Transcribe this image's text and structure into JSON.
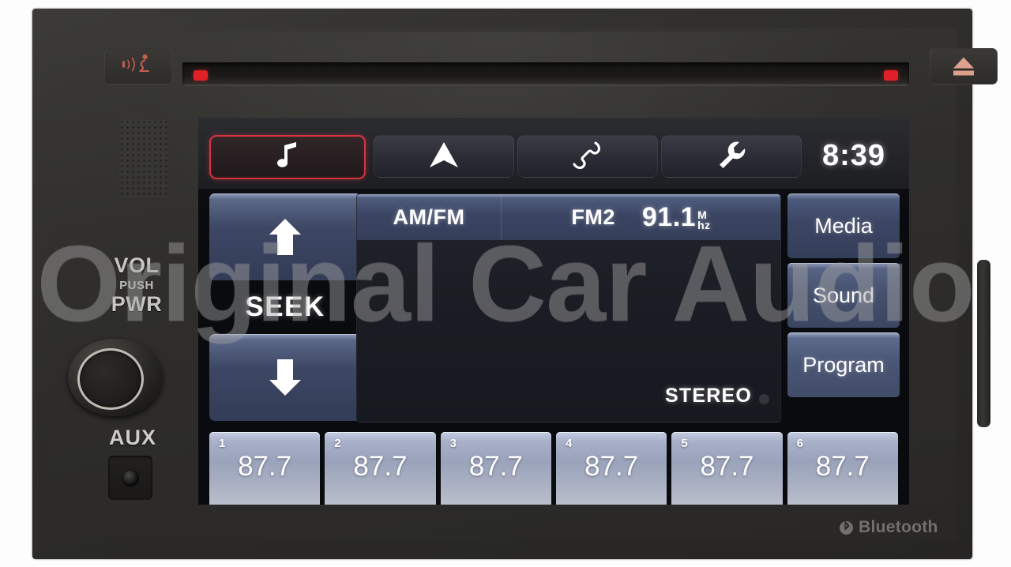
{
  "watermark": {
    "text": "Original Car Audio"
  },
  "device": {
    "brand_mark": "Bluetooth",
    "voice_button_icon": "voice-command-icon",
    "eject_button_icon": "eject-icon",
    "knob": {
      "label_main": "VOL",
      "label_push": "PUSH",
      "label_power": "PWR"
    },
    "aux": {
      "label": "AUX"
    }
  },
  "screen": {
    "tabs": [
      {
        "id": "music",
        "icon": "music-note-icon",
        "active": true
      },
      {
        "id": "nav",
        "icon": "navigation-arrow-icon",
        "active": false
      },
      {
        "id": "phone",
        "icon": "phone-handset-icon",
        "active": false
      },
      {
        "id": "settings",
        "icon": "wrench-icon",
        "active": false
      }
    ],
    "clock": "8:39",
    "seek": {
      "label": "SEEK",
      "up_icon": "arrow-up-icon",
      "down_icon": "arrow-down-icon"
    },
    "radio": {
      "source_label": "AM/FM",
      "band_label": "FM2",
      "frequency": "91.1",
      "unit_top": "M",
      "unit_bottom": "hz",
      "status": "STEREO"
    },
    "functions": [
      {
        "id": "media",
        "label": "Media"
      },
      {
        "id": "sound",
        "label": "Sound"
      },
      {
        "id": "program",
        "label": "Program"
      }
    ],
    "presets": [
      {
        "num": "1",
        "value": "87.7"
      },
      {
        "num": "2",
        "value": "87.7"
      },
      {
        "num": "3",
        "value": "87.7"
      },
      {
        "num": "4",
        "value": "87.7"
      },
      {
        "num": "5",
        "value": "87.7"
      },
      {
        "num": "6",
        "value": "87.7"
      }
    ]
  },
  "colors": {
    "accent_active_tab": "#d3303a",
    "cd_led": "#e02028",
    "eject_glyph": "#dda08c",
    "button_blue": "#3b4563",
    "preset_face": "#a7b0c8"
  }
}
